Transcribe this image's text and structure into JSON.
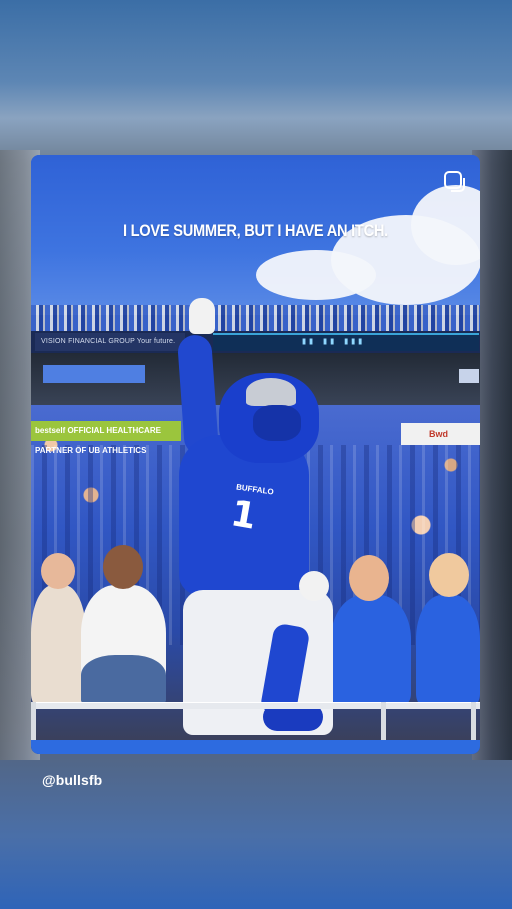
{
  "story": {
    "caption": "I LOVE SUMMER, BUT I HAVE AN ITCH.",
    "username": "@bullsfb",
    "image_icon": "copy-icon"
  },
  "photo": {
    "ad_upper_left": "VISION FINANCIAL GROUP   Your future. Our focus.",
    "ad_lower_left": "bestself  OFFICIAL HEALTHCARE PARTNER OF UB ATHLETICS",
    "ad_lower_right": "Bwd",
    "jersey_name": "BUFFALO",
    "jersey_number": "1"
  },
  "colors": {
    "accent_blue": "#1f47d0",
    "sky_blue": "#2f62d6",
    "text_white": "#ffffff"
  }
}
